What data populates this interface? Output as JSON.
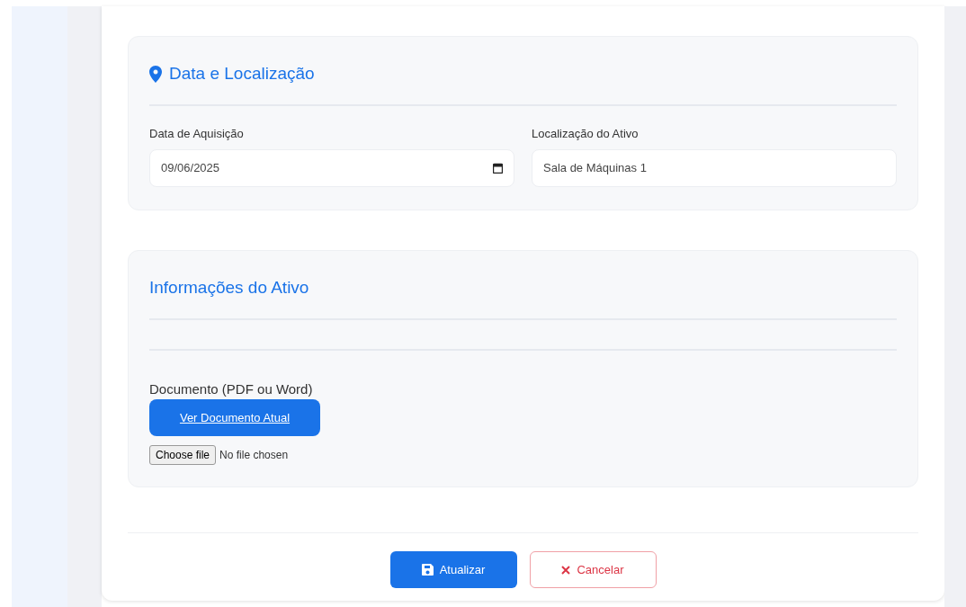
{
  "sections": [
    {
      "kind": "location",
      "title": "Data e Localização",
      "fields": [
        {
          "label": "Data de Aquisição",
          "kind": "date",
          "value": "09/06/2025"
        },
        {
          "label": "Localização do Ativo",
          "kind": "text",
          "value": "Sala de Máquinas 1"
        }
      ]
    },
    {
      "kind": "document",
      "title": "Informações do Ativo",
      "document_label": "Documento (PDF ou Word)",
      "view_button": "Ver Documento Atual",
      "file_button": "Choose file",
      "file_status": "No file chosen"
    }
  ],
  "actions": [
    {
      "kind": "primary",
      "label": "Atualizar"
    },
    {
      "kind": "cancel",
      "label": "Cancelar"
    }
  ]
}
